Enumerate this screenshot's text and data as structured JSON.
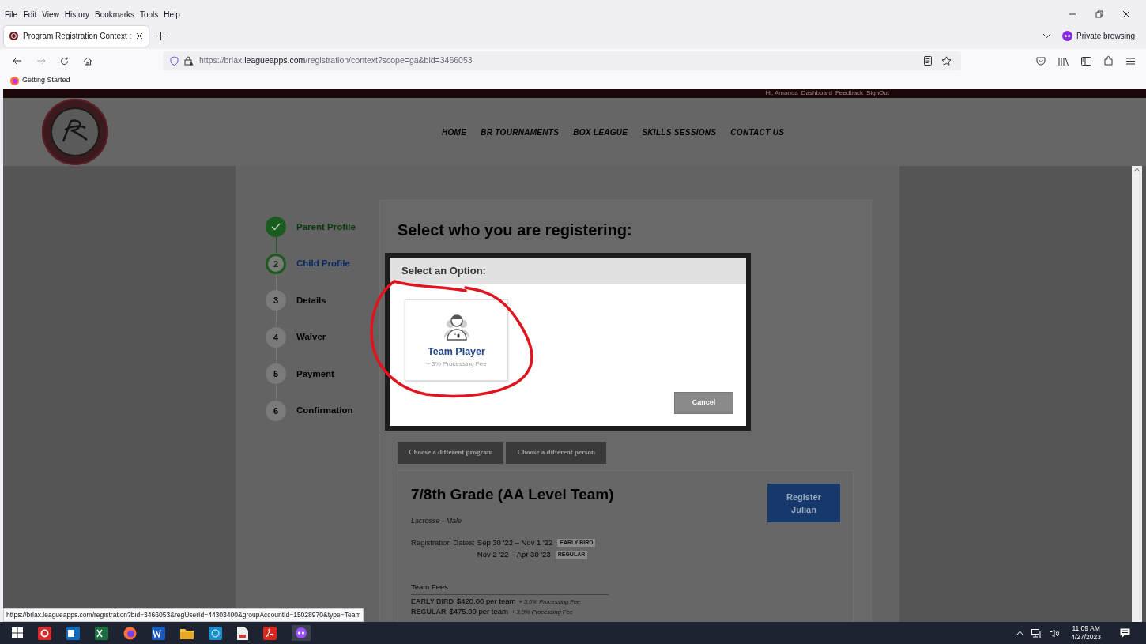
{
  "browser": {
    "menu": [
      "File",
      "Edit",
      "View",
      "History",
      "Bookmarks",
      "Tools",
      "Help"
    ],
    "tabs": [
      {
        "title": "Program Registration Context :",
        "selected": true
      }
    ],
    "private_label": "Private browsing",
    "url": {
      "prefix": "https://brlax.",
      "domain": "leagueapps.com",
      "path": "/registration/context?scope=ga&bid=3466053"
    },
    "bookmarks": [
      "Getting Started"
    ],
    "status_url": "https://brlax.leagueapps.com/registration?bid=3466053&regUserId=44303400&groupAccountId=15028970&type=Team"
  },
  "site": {
    "user_links": [
      "Hi, Amanda",
      "Dashboard",
      "Feedback",
      "SignOut"
    ],
    "nav": [
      "HOME",
      "BR TOURNAMENTS",
      "BOX LEAGUE",
      "SKILLS SESSIONS",
      "CONTACT US"
    ]
  },
  "steps": [
    {
      "label": "Parent Profile",
      "done": true,
      "current": false
    },
    {
      "label": "Child Profile",
      "number": "2",
      "done": false,
      "current": true
    },
    {
      "label": "Details",
      "number": "3",
      "done": false,
      "current": false
    },
    {
      "label": "Waiver",
      "number": "4",
      "done": false,
      "current": false
    },
    {
      "label": "Payment",
      "number": "5",
      "done": false,
      "current": false
    },
    {
      "label": "Confirmation",
      "number": "6",
      "done": false,
      "current": false
    }
  ],
  "heading": "Select who you are registering:",
  "modal": {
    "title": "Select an Option:",
    "options": [
      {
        "title": "Team Player",
        "subtitle": "+ 3% Processing Fee"
      }
    ],
    "cancel": "Cancel"
  },
  "actions": [
    "Choose a different program",
    "Choose a different person"
  ],
  "program": {
    "title": "7/8th Grade (AA Level Team)",
    "subtitle": "Lacrosse - Male",
    "dates_label": "Registration Dates:",
    "dates": [
      {
        "range": "Sep 30 '22 – Nov 1 '22",
        "tag": "EARLY BIRD"
      },
      {
        "range": "Nov 2 '22 – Apr 30 '23",
        "tag": "REGULAR"
      }
    ],
    "fees_title": "Team Fees",
    "fees": [
      {
        "tag": "EARLY BIRD",
        "price": "$420.00 per team",
        "note": "+ 3.0% Processing Fee"
      },
      {
        "tag": "REGULAR",
        "price": "$475.00 per team",
        "note": "+ 3.0% Processing Fee"
      }
    ],
    "register": "Register Julian"
  },
  "taskbar": {
    "time": "11:09 AM",
    "date": "4/27/2023"
  }
}
